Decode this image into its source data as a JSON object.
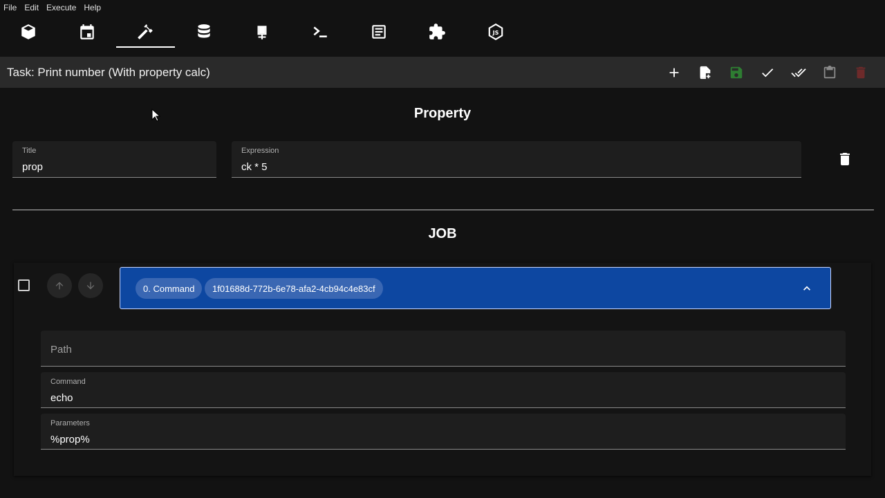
{
  "menu": [
    "File",
    "Edit",
    "Execute",
    "Help"
  ],
  "toolbar": {
    "icons": [
      "package-icon",
      "calendar-icon",
      "hammer-icon",
      "database-icon",
      "network-icon",
      "terminal-icon",
      "document-icon",
      "puzzle-icon",
      "nodejs-icon"
    ],
    "active_index": 2
  },
  "task": {
    "title": "Task: Print number (With property calc)",
    "actions": [
      "add-icon",
      "add-file-icon",
      "save-icon",
      "check-icon",
      "double-check-icon",
      "clipboard-icon",
      "delete-icon"
    ]
  },
  "property_section": {
    "heading": "Property",
    "title_field": {
      "label": "Title",
      "value": "prop"
    },
    "expression_field": {
      "label": "Expression",
      "value": "ck * 5"
    }
  },
  "job_section": {
    "heading": "JOB",
    "command_chip": "0. Command",
    "id_chip": "1f01688d-772b-6e78-afa2-4cb94c4e83cf",
    "path_field": {
      "placeholder": "Path"
    },
    "command_field": {
      "label": "Command",
      "value": "echo"
    },
    "parameters_field": {
      "label": "Parameters",
      "value": "%prop%"
    }
  },
  "colors": {
    "background": "#121212",
    "header_bar": "#2a2a2a",
    "accordion": "#0d47a1",
    "chip": "#3a67b3",
    "save_disabled": "#2e7d32",
    "delete_disabled": "#6d2a2a"
  }
}
